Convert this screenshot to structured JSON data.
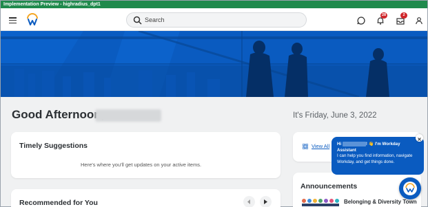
{
  "environment_bar": {
    "label": "Implementation Preview - highradius_dpt1"
  },
  "header": {
    "search_placeholder": "Search",
    "notifications_count": "28",
    "inbox_count": "2"
  },
  "greeting": {
    "text": "Good Afternoon,"
  },
  "date_text": "It's Friday, June 3, 2022",
  "timely_suggestions": {
    "title": "Timely Suggestions",
    "empty_text": "Here's where you'll get updates on your active items."
  },
  "recommended": {
    "title": "Recommended for You"
  },
  "quick_links": {
    "view_all": "View All"
  },
  "announcements": {
    "title": "Announcements",
    "items": [
      {
        "title": "Belonging & Diversity Town"
      }
    ]
  },
  "assistant": {
    "greeting_prefix": "Hi",
    "greeting_suffix": "! 👋 I'm Workday Assistant",
    "message": "I can help you find information, navigate Workday, and get things done."
  },
  "colors": {
    "brand_blue": "#0a5bc0",
    "env_green": "#1f8a4c",
    "badge_red": "#d0272b"
  },
  "icons": [
    "menu-icon",
    "workday-logo",
    "search-icon",
    "chat-icon",
    "bell-icon",
    "inbox-icon",
    "profile-icon",
    "grid-icon",
    "chevron-left-icon",
    "chevron-right-icon",
    "close-icon"
  ]
}
